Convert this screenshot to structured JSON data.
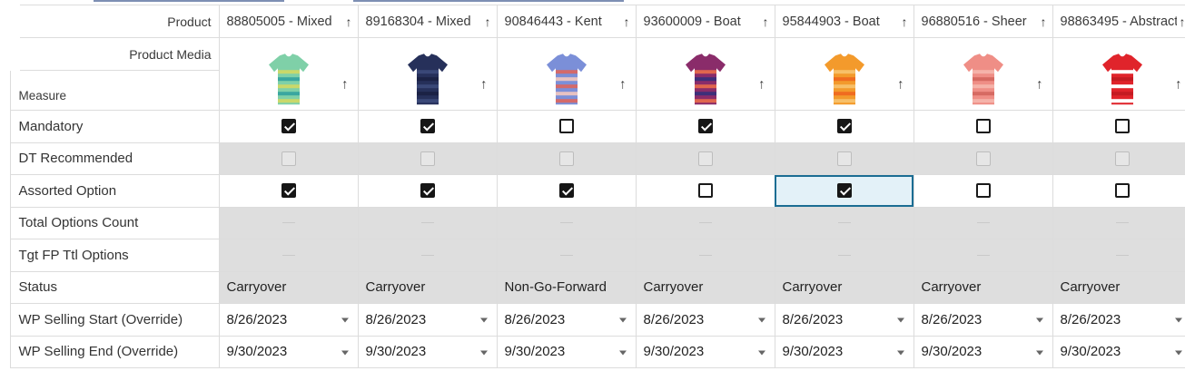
{
  "header": {
    "product_label": "Product",
    "media_label": "Product Media",
    "measure_label": "Measure"
  },
  "products": [
    {
      "name": "88805005 - Mixed",
      "media_icon": "cardigan-green-striped",
      "colors": [
        "#7fd0a8",
        "#c9d86a",
        "#3aa7a0"
      ]
    },
    {
      "name": "89168304 - Mixed",
      "media_icon": "cardigan-navy",
      "colors": [
        "#26305a",
        "#3a4878",
        "#1b2245"
      ]
    },
    {
      "name": "90846443 - Kent",
      "media_icon": "plaid-shirt",
      "colors": [
        "#7b8fd8",
        "#d46a6a",
        "#e7c2c2"
      ]
    },
    {
      "name": "93600009 - Boat",
      "media_icon": "tank-top-pattern",
      "colors": [
        "#8a2c6a",
        "#e0664e",
        "#3d2f7a"
      ]
    },
    {
      "name": "95844903 - Boat",
      "media_icon": "tshirt-orange-striped",
      "colors": [
        "#f39a2c",
        "#f7c069",
        "#f06c20"
      ]
    },
    {
      "name": "96880516 - Sheer",
      "media_icon": "shirt-pink-print",
      "colors": [
        "#ef8e86",
        "#f5b3aa",
        "#d66a62"
      ]
    },
    {
      "name": "98863495 - Abstract",
      "media_icon": "tshirt-red-striped",
      "colors": [
        "#e0242b",
        "#ffffff",
        "#c41b22"
      ]
    }
  ],
  "rows": {
    "mandatory": {
      "label": "Mandatory",
      "values": [
        true,
        true,
        false,
        true,
        true,
        false,
        false
      ]
    },
    "dt_recommended": {
      "label": "DT Recommended",
      "values": [
        false,
        false,
        false,
        false,
        false,
        false,
        false
      ]
    },
    "assorted_option": {
      "label": "Assorted Option",
      "values": [
        true,
        true,
        true,
        false,
        true,
        false,
        false
      ],
      "selected_index": 4
    },
    "total_options_count": {
      "label": "Total Options Count"
    },
    "tgt_fp_ttl_options": {
      "label": "Tgt FP Ttl Options"
    },
    "status": {
      "label": "Status",
      "values": [
        "Carryover",
        "Carryover",
        "Non-Go-Forward",
        "Carryover",
        "Carryover",
        "Carryover",
        "Carryover"
      ]
    },
    "wp_selling_start": {
      "label": "WP Selling Start (Override)",
      "values": [
        "8/26/2023",
        "8/26/2023",
        "8/26/2023",
        "8/26/2023",
        "8/26/2023",
        "8/26/2023",
        "8/26/2023"
      ]
    },
    "wp_selling_end": {
      "label": "WP Selling End (Override)",
      "values": [
        "9/30/2023",
        "9/30/2023",
        "9/30/2023",
        "9/30/2023",
        "9/30/2023",
        "9/30/2023",
        "9/30/2023"
      ]
    }
  },
  "icons": {
    "sort": "↑",
    "dropdown": "chevron-down-icon"
  },
  "colors": {
    "selection_border": "#1b6d93",
    "selection_fill": "#e3f1f8",
    "readonly_fill": "#dedede"
  }
}
